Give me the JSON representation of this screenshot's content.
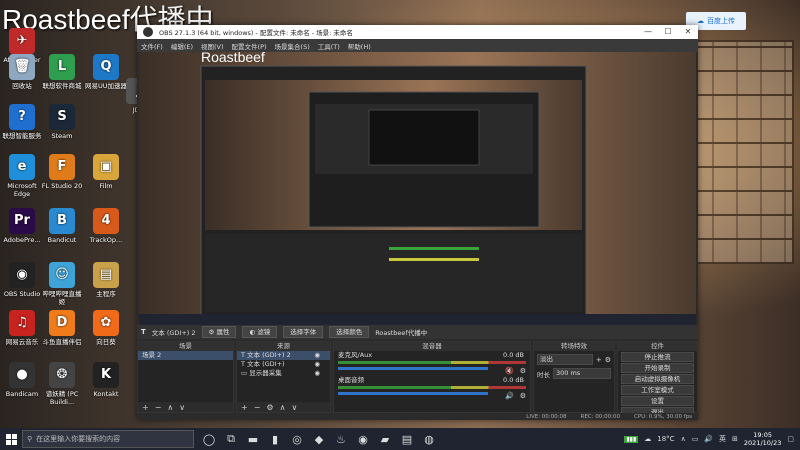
{
  "overlay": {
    "title": "Roastbeef",
    "suffix": "代播中"
  },
  "top_widget": {
    "label": "百度上传"
  },
  "desktop_icons": [
    {
      "label": "Afterburner",
      "glyph": "✈",
      "color": "#c02a2a"
    },
    {
      "label": "回收站",
      "glyph": "🗑",
      "color": "#8fa8c2"
    },
    {
      "label": "联想软件商城",
      "glyph": "L",
      "color": "#2f9e4e"
    },
    {
      "label": "网易UU加速器",
      "glyph": "Q",
      "color": "#1e78c8"
    },
    {
      "label": "JDM",
      "glyph": "J",
      "color": "#555"
    },
    {
      "label": "联想智能服务",
      "glyph": "?",
      "color": "#1f6fd0"
    },
    {
      "label": "Steam",
      "glyph": "S",
      "color": "#1b2838"
    },
    {
      "label": "Microsoft Edge",
      "glyph": "e",
      "color": "#1e8fd8"
    },
    {
      "label": "FL Studio 20",
      "glyph": "F",
      "color": "#e07b1a"
    },
    {
      "label": "Film",
      "glyph": "▣",
      "color": "#d8a63a"
    },
    {
      "label": "AdobePre...",
      "glyph": "Pr",
      "color": "#2a0a48"
    },
    {
      "label": "Bandicut",
      "glyph": "B",
      "color": "#2a8ad0"
    },
    {
      "label": "TrackOp...",
      "glyph": "4",
      "color": "#d85a1a"
    },
    {
      "label": "OBS Studio",
      "glyph": "◉",
      "color": "#222"
    },
    {
      "label": "哔哩哔哩直播姬",
      "glyph": "☺",
      "color": "#3ea4d8"
    },
    {
      "label": "主程序",
      "glyph": "▤",
      "color": "#c9a14a"
    },
    {
      "label": "网易云音乐",
      "glyph": "♫",
      "color": "#c8231e"
    },
    {
      "label": "斗鱼直播伴侣",
      "glyph": "D",
      "color": "#f07b1a"
    },
    {
      "label": "向日葵",
      "glyph": "✿",
      "color": "#f06a1a"
    },
    {
      "label": "Bandicam",
      "glyph": "●",
      "color": "#333"
    },
    {
      "label": "谱妖精 (PC Buildi...",
      "glyph": "❂",
      "color": "#444"
    },
    {
      "label": "Kontakt",
      "glyph": "K",
      "color": "#222"
    }
  ],
  "obs": {
    "title": "OBS 27.1.3 (64 bit, windows) - 配置文件: 未命名 - 场景: 未命名",
    "menu": [
      "文件(F)",
      "编辑(E)",
      "视图(V)",
      "配置文件(P)",
      "场景集合(S)",
      "工具(T)",
      "帮助(H)"
    ],
    "toolbar": {
      "source_label": "文本 (GDI+) 2",
      "props": "属性",
      "filters": "滤镜",
      "select_file": "选择字体",
      "select_color": "选择颜色",
      "text_value": "Roastbeef代播中"
    },
    "docks": {
      "scenes": {
        "header": "场景",
        "items": [
          "场景 2"
        ]
      },
      "sources": {
        "header": "来源",
        "items": [
          "文本 (GDI+) 2",
          "文本 (GDI+)",
          "显示器采集"
        ]
      },
      "mixer": {
        "header": "混音器",
        "channels": [
          {
            "name": "麦克风/Aux",
            "db": "0.0 dB"
          },
          {
            "name": "桌面音频",
            "db": "0.0 dB"
          }
        ]
      },
      "transitions": {
        "header": "转场特效",
        "type": "淡出",
        "duration_label": "时长",
        "duration_value": "300 ms"
      },
      "controls": {
        "header": "控件",
        "buttons": [
          "停止推流",
          "开始录制",
          "启动虚拟摄像机",
          "工作室模式",
          "设置",
          "退出"
        ]
      }
    },
    "status": {
      "live": "LIVE: 00:00:08",
      "rec": "REC: 00:00:00",
      "cpu": "CPU: 0.9%, 30.00 fps"
    }
  },
  "taskbar": {
    "search_placeholder": "在这里输入你要搜索的内容",
    "apps": [
      "◯",
      "⧉",
      "▬",
      "▮",
      "◎",
      "◆",
      "♨",
      "◉",
      "▰",
      "▤",
      "◍"
    ],
    "weather": "18°C",
    "ime": "英",
    "time": "19:05",
    "date": "2021/10/23"
  }
}
